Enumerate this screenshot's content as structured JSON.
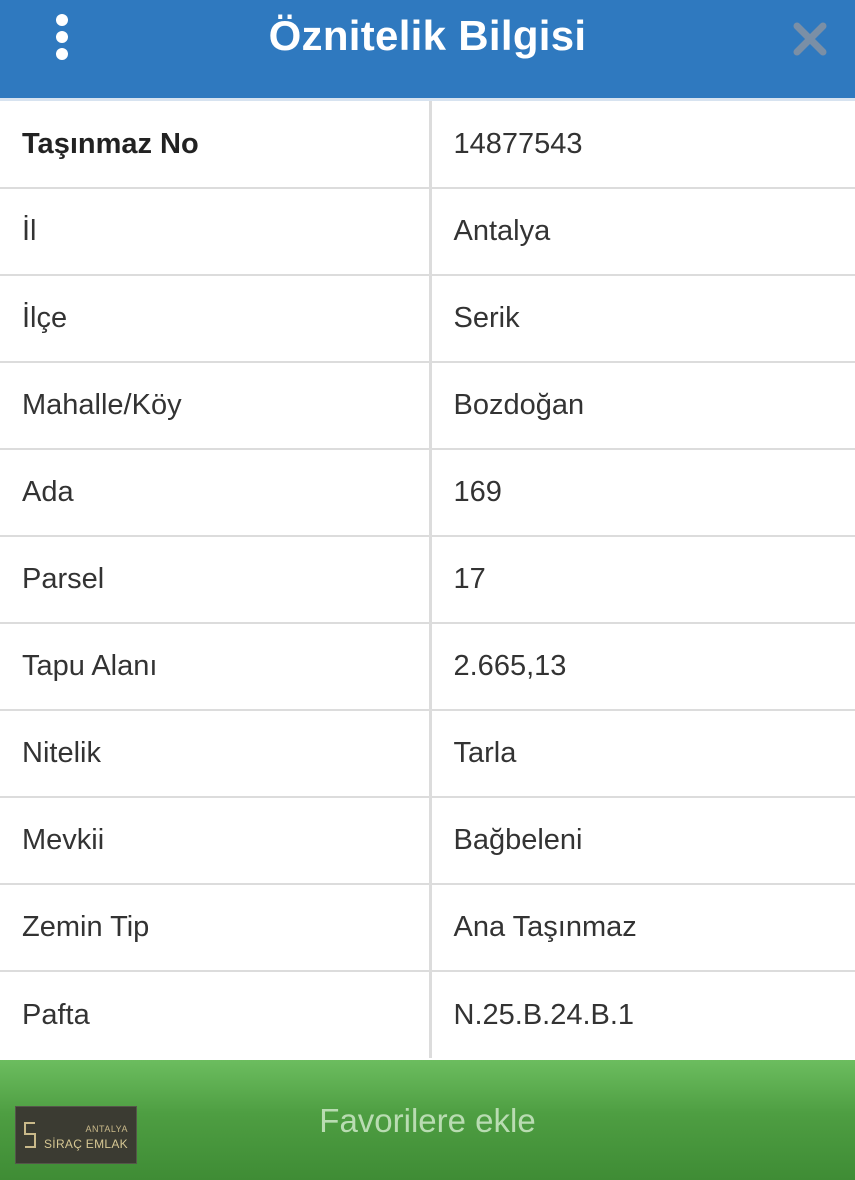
{
  "header": {
    "title": "Öznitelik Bilgisi",
    "menu_icon": "more-vertical-icon",
    "close_icon": "close-icon",
    "background_color": "#2f79bf"
  },
  "attributes": [
    {
      "key": "Taşınmaz No",
      "value": "14877543"
    },
    {
      "key": "İl",
      "value": "Antalya"
    },
    {
      "key": "İlçe",
      "value": "Serik"
    },
    {
      "key": "Mahalle/Köy",
      "value": "Bozdoğan"
    },
    {
      "key": "Ada",
      "value": "169"
    },
    {
      "key": "Parsel",
      "value": "17"
    },
    {
      "key": "Tapu Alanı",
      "value": "2.665,13"
    },
    {
      "key": "Nitelik",
      "value": "Tarla"
    },
    {
      "key": "Mevkii",
      "value": "Bağbeleni"
    },
    {
      "key": "Zemin Tip",
      "value": "Ana Taşınmaz"
    },
    {
      "key": "Pafta",
      "value": "N.25.B.24.B.1"
    }
  ],
  "footer": {
    "button_label": "Favorilere ekle",
    "button_color": "#4e9e42"
  },
  "logo": {
    "small_text": "ANTALYA",
    "name": "SİRAÇ EMLAK"
  }
}
